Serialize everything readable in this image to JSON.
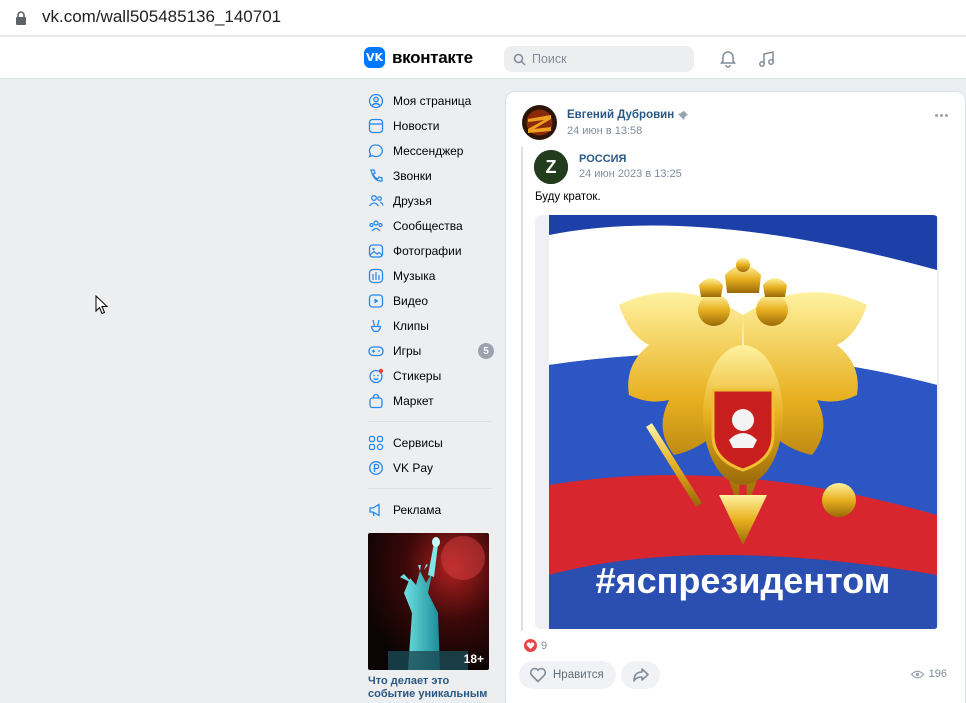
{
  "browser": {
    "url": "vk.com/wall505485136_140701"
  },
  "header": {
    "logo_text": "вконтакте",
    "search_placeholder": "Поиск"
  },
  "nav": {
    "items": [
      {
        "label": "Моя страница",
        "icon": "user-circle-icon"
      },
      {
        "label": "Новости",
        "icon": "newsfeed-icon"
      },
      {
        "label": "Мессенджер",
        "icon": "message-icon"
      },
      {
        "label": "Звонки",
        "icon": "phone-icon"
      },
      {
        "label": "Друзья",
        "icon": "friends-icon"
      },
      {
        "label": "Сообщества",
        "icon": "communities-icon"
      },
      {
        "label": "Фотографии",
        "icon": "photo-icon"
      },
      {
        "label": "Музыка",
        "icon": "music-icon"
      },
      {
        "label": "Видео",
        "icon": "video-icon"
      },
      {
        "label": "Клипы",
        "icon": "clips-icon"
      },
      {
        "label": "Игры",
        "icon": "games-icon",
        "badge": "5"
      },
      {
        "label": "Стикеры",
        "icon": "stickers-icon"
      },
      {
        "label": "Маркет",
        "icon": "market-icon"
      }
    ],
    "items2": [
      {
        "label": "Сервисы",
        "icon": "services-icon"
      },
      {
        "label": "VK Pay",
        "icon": "vkpay-icon"
      }
    ],
    "items3": [
      {
        "label": "Реклама",
        "icon": "ads-icon"
      }
    ]
  },
  "ad": {
    "age": "18+",
    "caption": "Что делает это событие уникальным"
  },
  "post": {
    "author": "Евгений Дубровин",
    "time": "24 июн в 13:58",
    "repost": {
      "author": "РОССИЯ",
      "time": "24 июн 2023 в 13:25",
      "text": "Буду краток.",
      "image_caption": "#яспрезидентом"
    },
    "likes": "9",
    "like_label": "Нравится",
    "views": "196"
  },
  "colors": {
    "accent": "#0077ff",
    "link": "#2a5885",
    "muted": "#818c99",
    "like_red": "#e64646"
  }
}
